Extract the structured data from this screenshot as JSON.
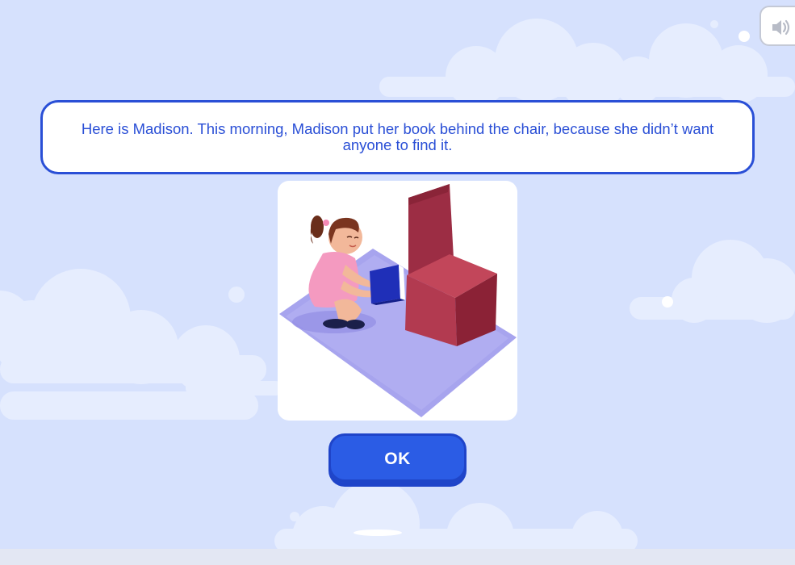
{
  "prompt": {
    "text": "Here is Madison. This morning, Madison put her book behind the chair, because she didn’t want anyone to find it."
  },
  "actions": {
    "ok_label": "OK"
  },
  "icons": {
    "sound": "speaker-volume-icon"
  },
  "colors": {
    "background": "#d6e1fd",
    "accent": "#2a4fd6",
    "button": "#2b5ce5",
    "cloud": "#e8eefe"
  }
}
